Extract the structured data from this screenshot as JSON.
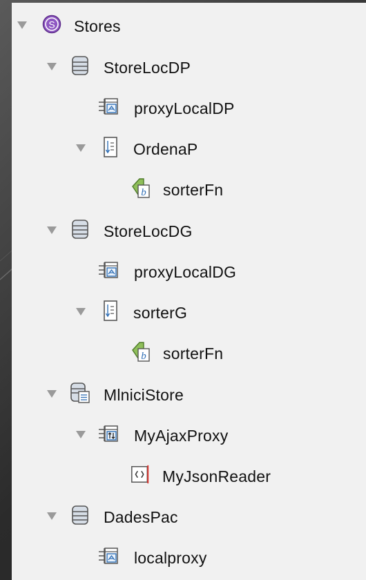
{
  "tree": {
    "root": {
      "label": "Stores",
      "icon": "stores-icon",
      "expanded": true
    },
    "nodes": [
      {
        "label": "StoreLocDP",
        "icon": "store-icon",
        "level": 1,
        "expanded": true
      },
      {
        "label": "proxyLocalDP",
        "icon": "local-proxy-icon",
        "level": 2
      },
      {
        "label": "OrdenaP",
        "icon": "sorter-icon",
        "level": 2,
        "expanded": true
      },
      {
        "label": "sorterFn",
        "icon": "function-icon",
        "level": 3
      },
      {
        "label": "StoreLocDG",
        "icon": "store-icon",
        "level": 1,
        "expanded": true
      },
      {
        "label": "proxyLocalDG",
        "icon": "local-proxy-icon",
        "level": 2
      },
      {
        "label": "sorterG",
        "icon": "sorter-icon",
        "level": 2,
        "expanded": true
      },
      {
        "label": "sorterFn",
        "icon": "function-icon",
        "level": 3
      },
      {
        "label": "MlniciStore",
        "icon": "json-store-icon",
        "level": 1,
        "expanded": true
      },
      {
        "label": "MyAjaxProxy",
        "icon": "ajax-proxy-icon",
        "level": 2,
        "expanded": true
      },
      {
        "label": "MyJsonReader",
        "icon": "json-reader-icon",
        "level": 3
      },
      {
        "label": "DadesPac",
        "icon": "store-icon",
        "level": 1,
        "expanded": true
      },
      {
        "label": "localproxy",
        "icon": "local-proxy-icon",
        "level": 2
      }
    ]
  }
}
